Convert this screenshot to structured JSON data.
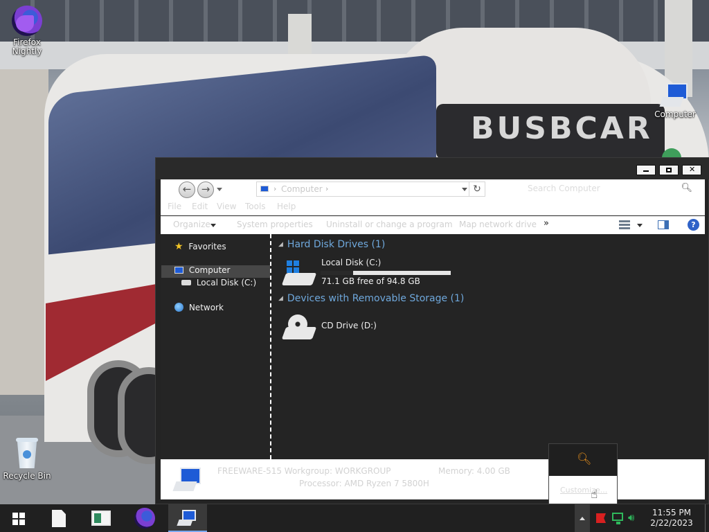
{
  "desktop": {
    "icons": [
      {
        "label": "Firefox Nightly",
        "icon": "firefox-nightly-icon"
      },
      {
        "label": "Computer",
        "icon": "computer-icon"
      },
      {
        "label": "Recycle Bin",
        "icon": "recycle-bin-icon"
      }
    ]
  },
  "explorer": {
    "address": {
      "crumb": "Computer"
    },
    "search_placeholder": "Search Computer",
    "menu": [
      "File",
      "Edit",
      "View",
      "Tools",
      "Help"
    ],
    "toolbar": {
      "organize": "Organize",
      "system_properties": "System properties",
      "uninstall": "Uninstall or change a program",
      "map_drive": "Map network drive",
      "more": "»"
    },
    "nav": {
      "favorites": "Favorites",
      "computer": "Computer",
      "local_disk": "Local Disk (C:)",
      "network": "Network"
    },
    "groups": {
      "hdd_header": "Hard Disk Drives (1)",
      "removable_header": "Devices with Removable Storage (1)"
    },
    "drives": {
      "c_name": "Local Disk (C:)",
      "c_free": "71.1 GB free of 94.8 GB",
      "c_used_fraction": 0.25,
      "d_name": "CD Drive (D:)"
    },
    "details": {
      "workgroup": "FREEWARE-515  Workgroup: WORKGROUP",
      "memory": "Memory: 4.00 GB",
      "processor": "Processor: AMD Ryzen 7 5800H"
    }
  },
  "popup": {
    "customize": "Customize..."
  },
  "taskbar": {
    "clock_time": "11:55 PM",
    "clock_date": "2/22/2023"
  }
}
